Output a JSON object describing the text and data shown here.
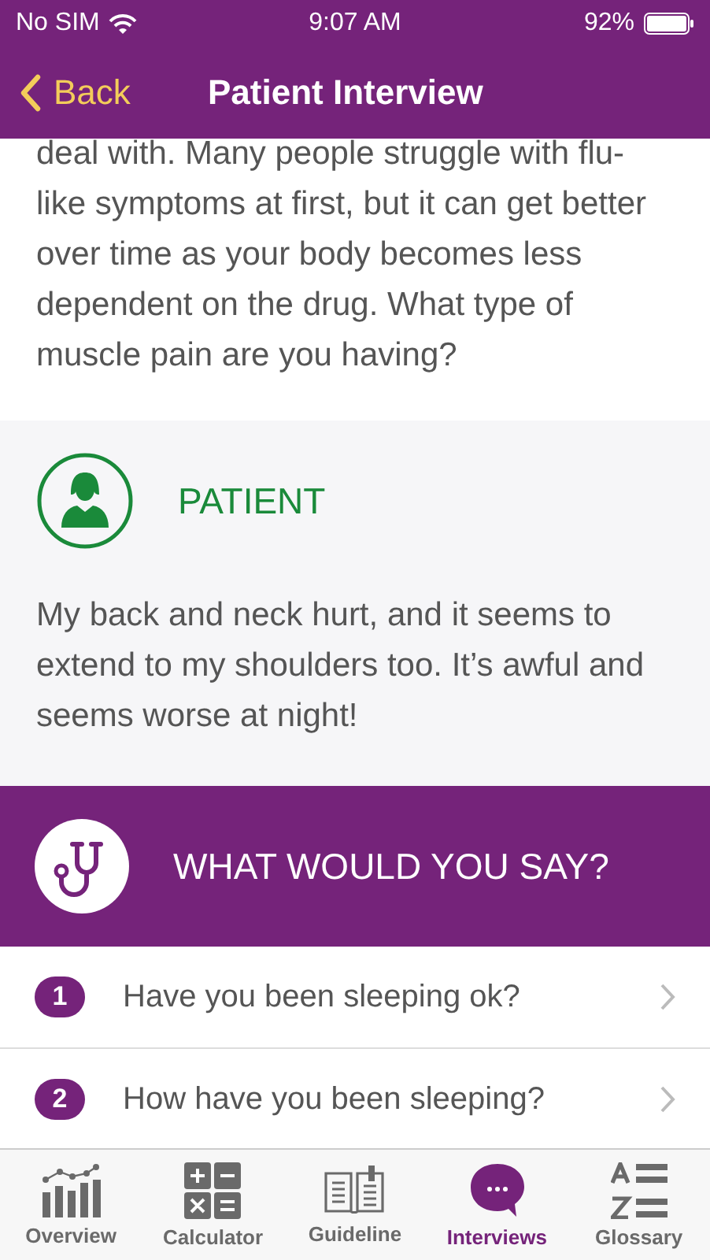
{
  "status_bar": {
    "carrier": "No SIM",
    "time": "9:07 AM",
    "battery": "92%"
  },
  "nav_bar": {
    "back": "Back",
    "title": "Patient Interview"
  },
  "doctor_message": {
    "text": "deal with. Many people struggle with flu-like symptoms at first, but it can get better over time as your body becomes less dependent on the drug. What type of muscle pain are you having?"
  },
  "patient_message": {
    "speaker": "PATIENT",
    "text": "My back and neck hurt, and it seems to extend to my shoulders too. It’s awful and seems worse at night!"
  },
  "prompt": {
    "title": "WHAT WOULD YOU SAY?"
  },
  "answers": [
    {
      "number": "1",
      "text": "Have you been sleeping ok?"
    },
    {
      "number": "2",
      "text": "How have you been sleeping?"
    }
  ],
  "tab_bar": [
    {
      "kind": "overview",
      "label": "Overview",
      "selected": false
    },
    {
      "kind": "calculator",
      "label": "Calculator",
      "selected": false
    },
    {
      "kind": "guideline",
      "label": "Guideline",
      "selected": false
    },
    {
      "kind": "interviews",
      "label": "Interviews",
      "selected": true
    },
    {
      "kind": "glossary",
      "label": "Glossary",
      "selected": false
    }
  ]
}
